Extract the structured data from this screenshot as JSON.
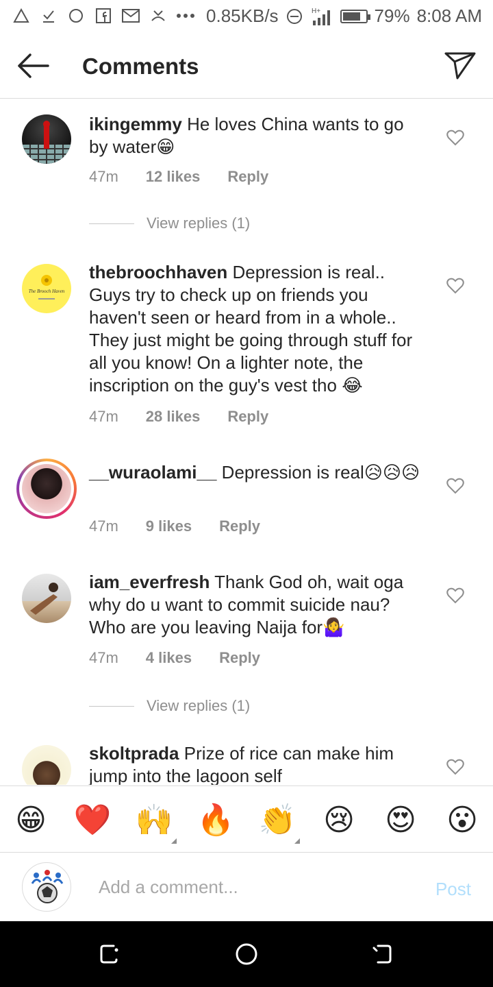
{
  "status_bar": {
    "speed": "0.85KB/s",
    "battery_percent_label": "79%",
    "battery_level": 0.79,
    "time": "8:08 AM",
    "network": "H+"
  },
  "header": {
    "title": "Comments",
    "back_icon": "back-arrow-icon",
    "send_icon": "direct-send-icon"
  },
  "comments": [
    {
      "username": "ikingemmy",
      "text": "He loves China wants to go by water",
      "emoji": "😁",
      "time": "47m",
      "likes": "12 likes",
      "reply": "Reply",
      "view_replies": "View replies (1)"
    },
    {
      "username": "thebroochhaven",
      "text": "Depression is real.. Guys try to check up on friends you haven't seen or heard from in a whole.. They just might be going through stuff for all you know! On a lighter note, the inscription on the guy's vest tho",
      "emoji": "😂",
      "time": "47m",
      "likes": "28 likes",
      "reply": "Reply",
      "avatar_text": "The Brooch Haven"
    },
    {
      "username": "__wuraolami__",
      "text": "Depression is real",
      "emoji": "😥😥😥",
      "time": "47m",
      "likes": "9 likes",
      "reply": "Reply"
    },
    {
      "username": "iam_everfresh",
      "text": "Thank God oh, wait oga why do u want to commit suicide nau? Who are you leaving Naija for",
      "emoji": "🤷‍♀️",
      "time": "47m",
      "likes": "4 likes",
      "reply": "Reply",
      "view_replies": "View replies (1)"
    },
    {
      "username": "skoltprada",
      "text": "Prize of rice can make him jump into the lagoon self",
      "emoji": ""
    }
  ],
  "reactions": [
    "😁",
    "❤️",
    "🙌",
    "🔥",
    "👏",
    "😢",
    "😍",
    "😮"
  ],
  "composer": {
    "placeholder": "Add a comment...",
    "post_label": "Post"
  },
  "colors": {
    "text": "#262626",
    "meta": "#8e8e8e",
    "divider": "#dbdbdb",
    "post_disabled": "#b2dffc",
    "nav_bg": "#000000"
  }
}
